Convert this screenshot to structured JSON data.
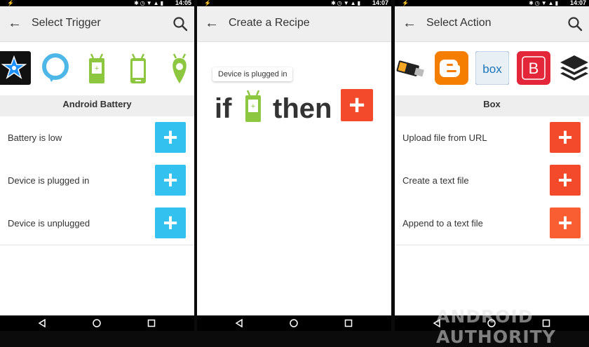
{
  "panels": [
    {
      "status": {
        "time": "14:05"
      },
      "title": "Select Trigger",
      "strip_icons": [
        "adafruit-icon",
        "amazon-echo-icon",
        "android-battery-icon",
        "android-device-icon",
        "android-location-icon"
      ],
      "section": "Android Battery",
      "items": [
        {
          "label": "Battery is low"
        },
        {
          "label": "Device is plugged in"
        },
        {
          "label": "Device is unplugged"
        }
      ],
      "accent": "#33c2ef"
    },
    {
      "status": {
        "time": "14:07"
      },
      "title": "Create a Recipe",
      "tooltip": "Device is plugged in",
      "if_word": "if",
      "then_word": "then",
      "accent": "#f24a2b"
    },
    {
      "status": {
        "time": "14:07"
      },
      "title": "Select Action",
      "strip_icons": [
        "usb-drive-icon",
        "blogger-icon",
        "box-icon",
        "b-icon",
        "buffer-icon"
      ],
      "box_icon_text": "box",
      "b_icon_text": "B",
      "section": "Box",
      "items": [
        {
          "label": "Upload file from URL"
        },
        {
          "label": "Create a text file"
        },
        {
          "label": "Append to a text file"
        }
      ],
      "accent": "#f24a2b"
    }
  ],
  "add_symbol": "+",
  "watermark": "ANDROID AUTHORITY",
  "colors": {
    "battery_green": "#8dc63f",
    "blogger_orange": "#f57d00",
    "box_blue": "#1a74ba",
    "b_red": "#e3263a",
    "adafruit_bg": "#111111",
    "star_blue": "#1e90ff"
  }
}
